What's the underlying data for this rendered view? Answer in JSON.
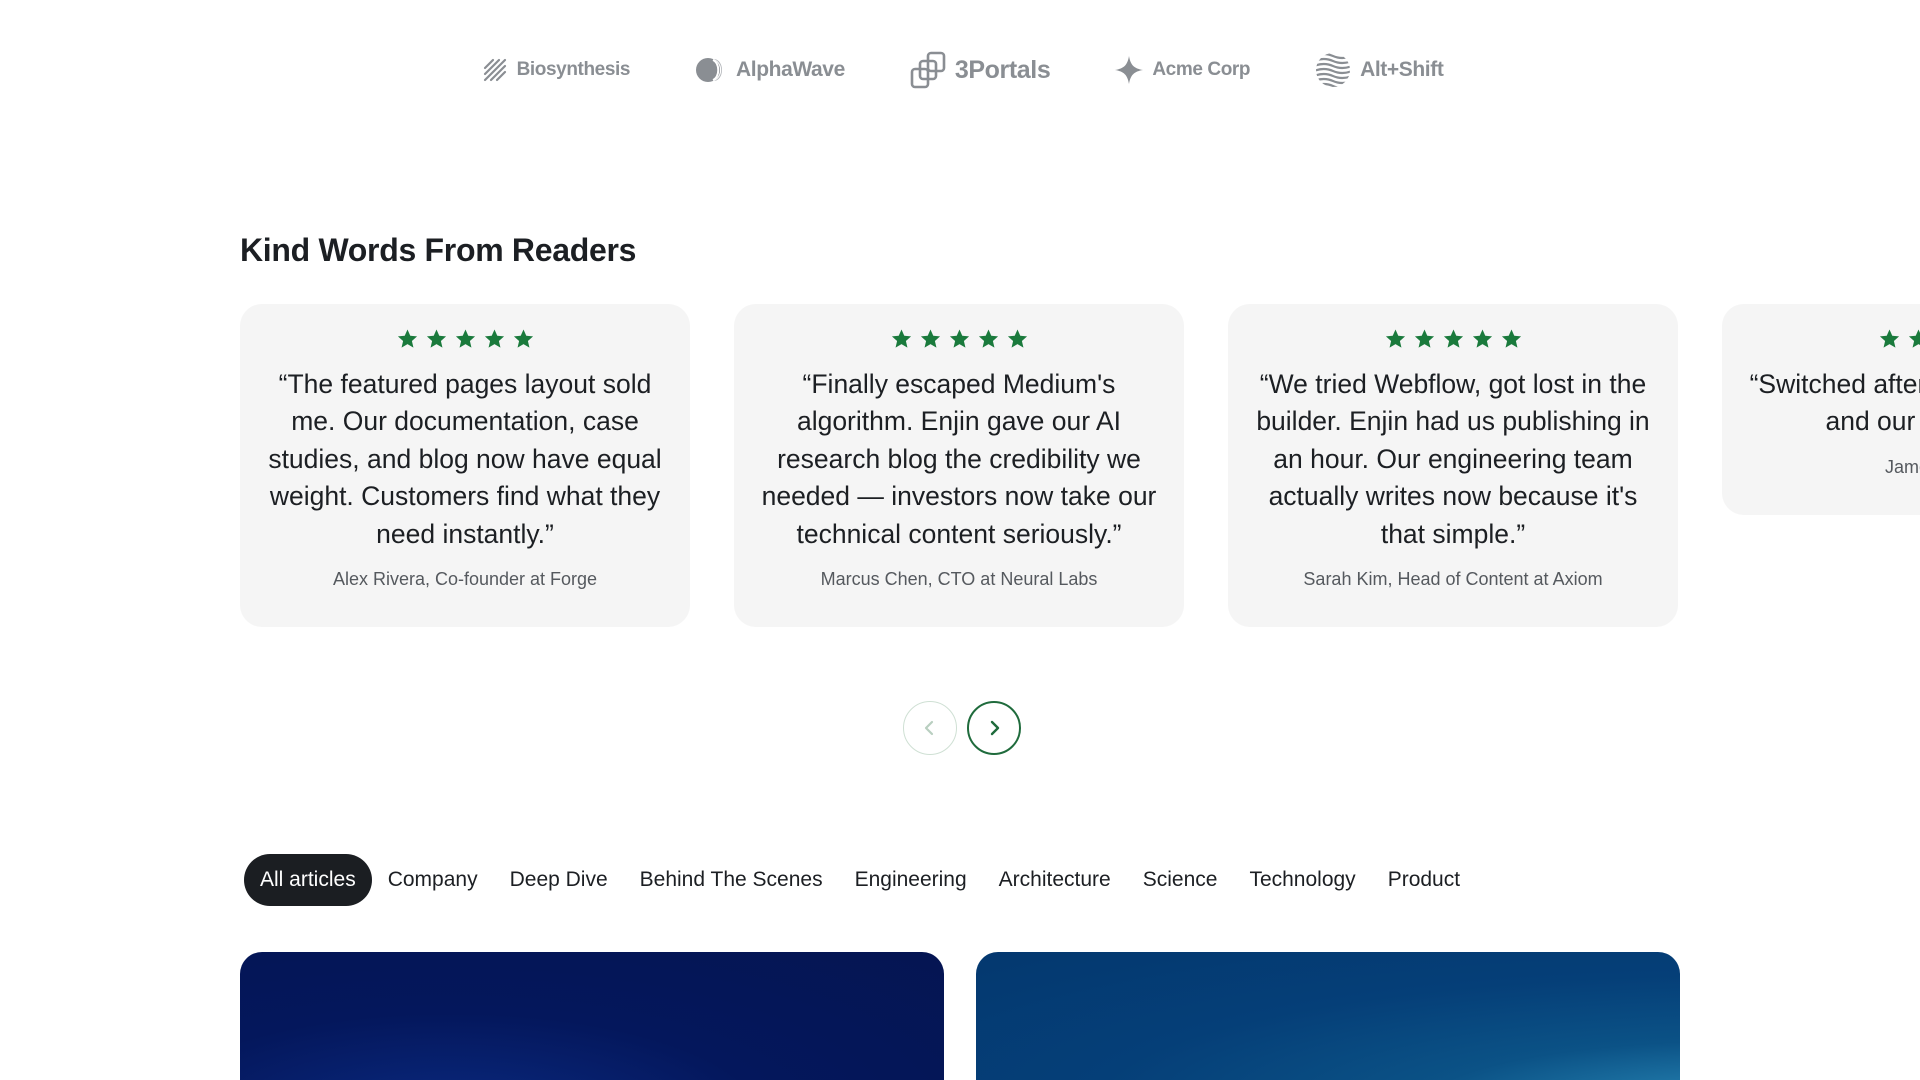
{
  "logos": [
    {
      "name": "Biosynthesis",
      "icon": "diagonal-lines-icon"
    },
    {
      "name": "AlphaWave",
      "icon": "half-circle-wave-icon"
    },
    {
      "name": "3Portals",
      "icon": "stacked-squares-icon"
    },
    {
      "name": "Acme Corp",
      "icon": "sparkle-star-icon"
    },
    {
      "name": "Alt+Shift",
      "icon": "wavy-globe-icon"
    }
  ],
  "testimonials_section": {
    "title": "Kind Words From Readers",
    "star_color": "#1a7a3c",
    "cards": [
      {
        "rating": 5,
        "quote": "“The featured pages layout sold me. Our documentation, case studies, and blog now have equal weight. Customers find what they need instantly.”",
        "author": "Alex Rivera, Co-founder at Forge"
      },
      {
        "rating": 5,
        "quote": "“Finally escaped Medium's algorithm. Enjin gave our AI research blog the credibility we needed — investors now take our technical content seriously.”",
        "author": "Marcus Chen, CTO at Neural Labs"
      },
      {
        "rating": 5,
        "quote": "“We tried Webflow, got lost in the builder. Enjin had us publishing in an hour. Our engineering team actually writes now because it's that simple.”",
        "author": "Sarah Kim, Head of Content at Axiom"
      },
      {
        "rating": 5,
        "quote": "“Switched after our thi Enjin loads and our SEO weeks.",
        "author": "James Mitchell,"
      }
    ],
    "nav": {
      "prev_icon": "chevron-left-icon",
      "next_icon": "chevron-right-icon"
    }
  },
  "filters": {
    "active_index": 0,
    "items": [
      "All articles",
      "Company",
      "Deep Dive",
      "Behind The Scenes",
      "Engineering",
      "Architecture",
      "Science",
      "Technology",
      "Product"
    ]
  },
  "colors": {
    "accent_green": "#1f6b3c",
    "active_pill": "#1b1e22",
    "card_bg": "#f5f5f5"
  }
}
